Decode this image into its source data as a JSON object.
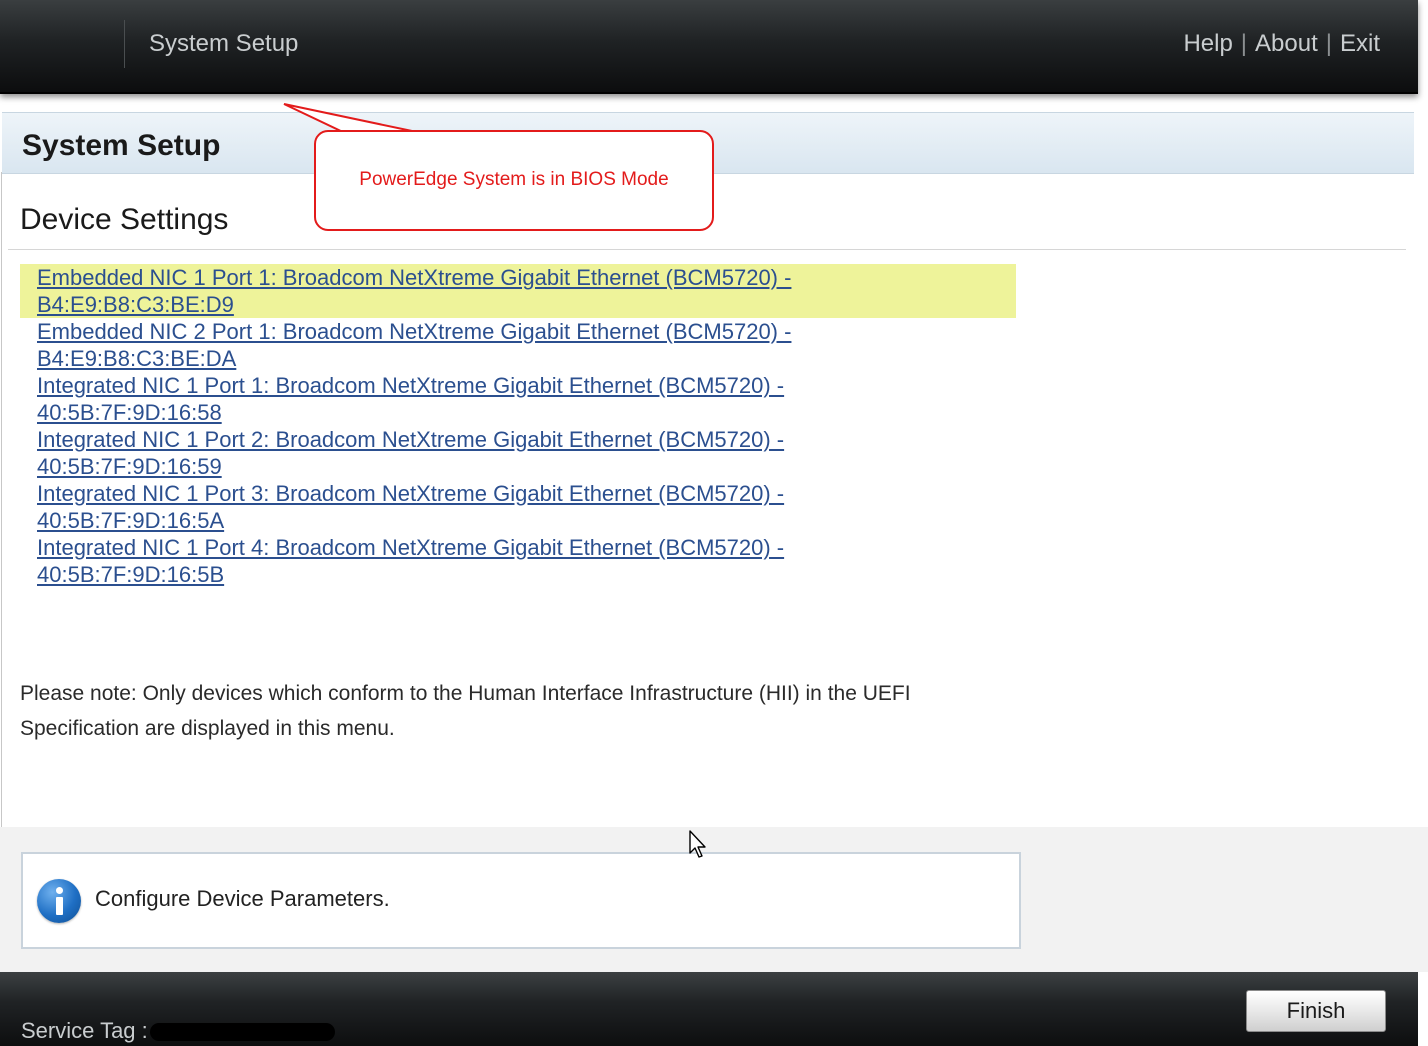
{
  "topbar": {
    "title": "System Setup",
    "links": {
      "help": "Help",
      "about": "About",
      "exit": "Exit",
      "separator": "|"
    }
  },
  "page": {
    "title": "System Setup",
    "section": "Device Settings"
  },
  "annotation": {
    "text": "PowerEdge System is in BIOS Mode",
    "color": "#e31b1b"
  },
  "devices": [
    {
      "label": "Embedded NIC 1 Port 1: Broadcom NetXtreme Gigabit Ethernet (BCM5720) - B4:E9:B8:C3:BE:D9",
      "selected": true
    },
    {
      "label": "Embedded NIC 2 Port 1: Broadcom NetXtreme Gigabit Ethernet (BCM5720) - B4:E9:B8:C3:BE:DA",
      "selected": false
    },
    {
      "label": "Integrated NIC 1 Port 1: Broadcom NetXtreme Gigabit Ethernet (BCM5720) - 40:5B:7F:9D:16:58",
      "selected": false
    },
    {
      "label": "Integrated NIC 1 Port 2: Broadcom NetXtreme Gigabit Ethernet (BCM5720) - 40:5B:7F:9D:16:59",
      "selected": false
    },
    {
      "label": "Integrated NIC 1 Port 3: Broadcom NetXtreme Gigabit Ethernet (BCM5720) - 40:5B:7F:9D:16:5A",
      "selected": false
    },
    {
      "label": "Integrated NIC 1 Port 4: Broadcom NetXtreme Gigabit Ethernet (BCM5720) - 40:5B:7F:9D:16:5B",
      "selected": false
    }
  ],
  "note": "Please note: Only devices which conform to the Human Interface Infrastructure (HII) in the UEFI Specification are displayed in this menu.",
  "help_panel": {
    "icon": "info-icon",
    "text": "Configure Device Parameters."
  },
  "footer": {
    "service_tag_label": "Service Tag :",
    "finish_label": "Finish"
  },
  "colors": {
    "link": "#2b4f8f",
    "selected_row": "#eef39a",
    "header_band": "#d9e6f0"
  }
}
